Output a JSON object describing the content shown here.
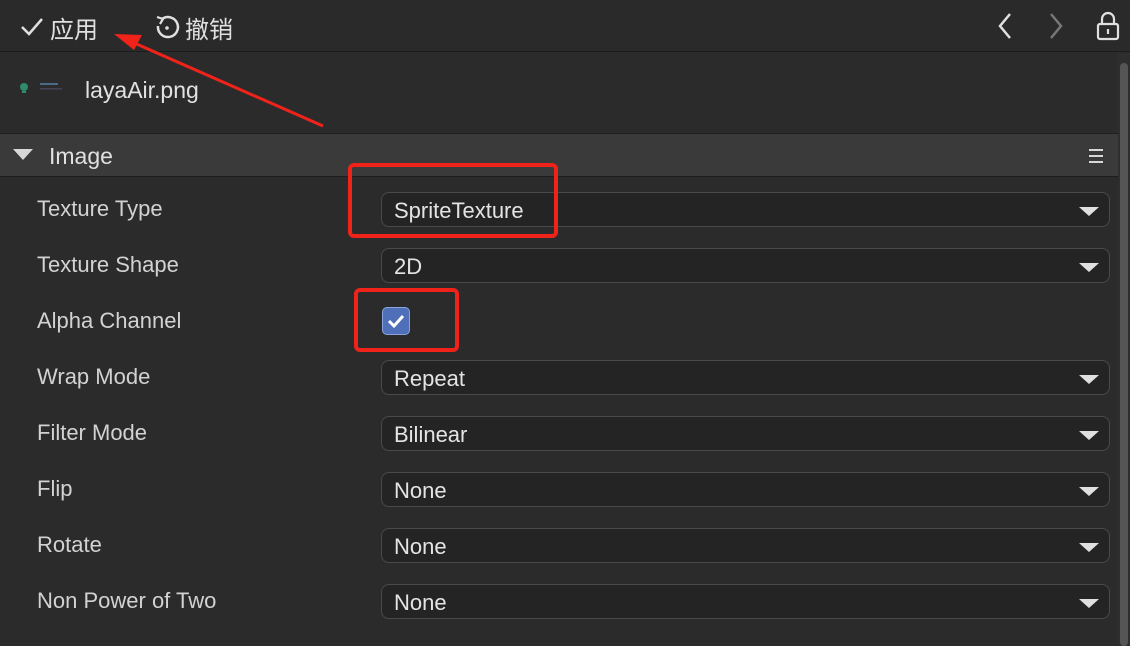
{
  "toolbar": {
    "apply_label": "应用",
    "undo_label": "撤销",
    "icons": [
      "check-icon",
      "undo-icon",
      "chevron-left-icon",
      "chevron-right-icon",
      "lock-icon"
    ]
  },
  "file": {
    "name": "layaAir.png"
  },
  "section": {
    "title": "Image",
    "expanded": true
  },
  "properties": {
    "texture_type": {
      "label": "Texture Type",
      "value": "SpriteTexture"
    },
    "texture_shape": {
      "label": "Texture Shape",
      "value": "2D"
    },
    "alpha_channel": {
      "label": "Alpha Channel",
      "checked": true
    },
    "wrap_mode": {
      "label": "Wrap Mode",
      "value": "Repeat"
    },
    "filter_mode": {
      "label": "Filter Mode",
      "value": "Bilinear"
    },
    "flip": {
      "label": "Flip",
      "value": "None"
    },
    "rotate": {
      "label": "Rotate",
      "value": "None"
    },
    "non_power_of_two": {
      "label": "Non Power of Two",
      "value": "None"
    }
  },
  "colors": {
    "annotation": "#f0231b",
    "checkbox": "#4f6fb8",
    "background": "#2b2b2b"
  }
}
